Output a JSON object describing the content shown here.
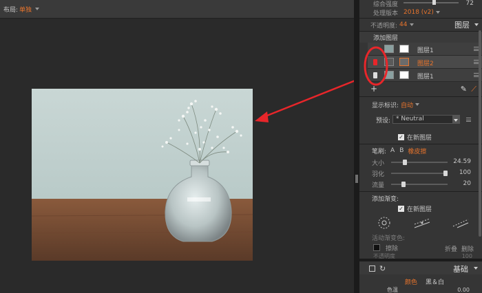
{
  "toolbar": {
    "layout_label": "布局:",
    "layout_value": "单独"
  },
  "panel": {
    "top": {
      "row1_label": "综合强度",
      "row1_value": "72",
      "row2_label": "处理版本",
      "row2_value": "2018 (v2)"
    },
    "opacity_label": "不透明度:",
    "opacity_value": "44",
    "layers_title": "图层",
    "add_layer_label": "添加图层",
    "layers": [
      {
        "name": "图层1"
      },
      {
        "name": "图层2"
      },
      {
        "name": "图层1"
      }
    ],
    "show_mark_label": "显示标识:",
    "show_mark_value": "自动",
    "preset_label": "预设:",
    "preset_value": "* Neutral",
    "new_layer_label": "在新图层",
    "brush_label": "笔刷:",
    "brush_a": "A",
    "brush_b": "B",
    "brush_erase": "橡皮擦",
    "sliders": [
      {
        "label": "大小",
        "value": "24.59",
        "fraction": 0.22
      },
      {
        "label": "羽化",
        "value": "100",
        "fraction": 1.0
      },
      {
        "label": "流量",
        "value": "20",
        "fraction": 0.2
      }
    ],
    "add_gradient_label": "添加渐变:",
    "new_layer_label2": "在新图层",
    "active_gradient_label": "活动渐变色:",
    "erase_label": "擦除",
    "flip_label": "折叠",
    "delete_label": "删除",
    "opacity2_label": "不透明度",
    "opacity2_value": "100",
    "bottom": {
      "basic_title": "基础",
      "color_tab": "颜色",
      "bw_tab": "黑＆白",
      "color_temp_label": "色温",
      "color_temp_value": "0.00"
    }
  },
  "colors": {
    "accent": "#e8742c",
    "annotation": "#e8262a"
  }
}
